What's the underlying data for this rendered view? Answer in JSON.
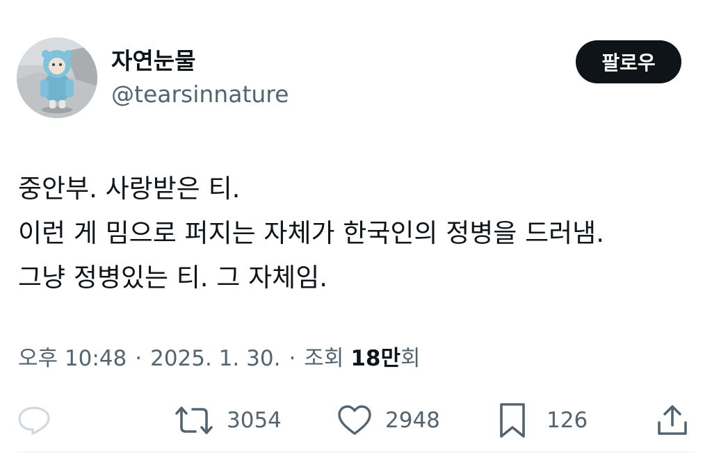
{
  "user": {
    "display_name": "자연눈물",
    "handle": "@tearsinnature"
  },
  "follow_button": {
    "label": "팔로우"
  },
  "tweet": {
    "lines": [
      "중안부. 사랑받은 티.",
      "이런 게 밈으로 퍼지는 자체가 한국인의 정병을 드러냄.",
      "그냥 정병있는 티. 그 자체임."
    ]
  },
  "meta": {
    "time": "오후 10:48",
    "separator": "·",
    "date": "2025. 1. 30.",
    "views_label": "조회",
    "views_count": "18만",
    "views_suffix": "회"
  },
  "actions": {
    "reply_icon": "speech-bubble-icon",
    "retweet_icon": "retweet-icon",
    "retweets": "3054",
    "like_icon": "heart-icon",
    "likes": "2948",
    "bookmark_icon": "bookmark-icon",
    "bookmarks": "126",
    "share_icon": "share-upload-icon"
  },
  "colors": {
    "text_primary": "#0f1419",
    "text_secondary": "#536471",
    "follow_bg": "#0f1419",
    "reply_icon": "#cfd9de"
  }
}
